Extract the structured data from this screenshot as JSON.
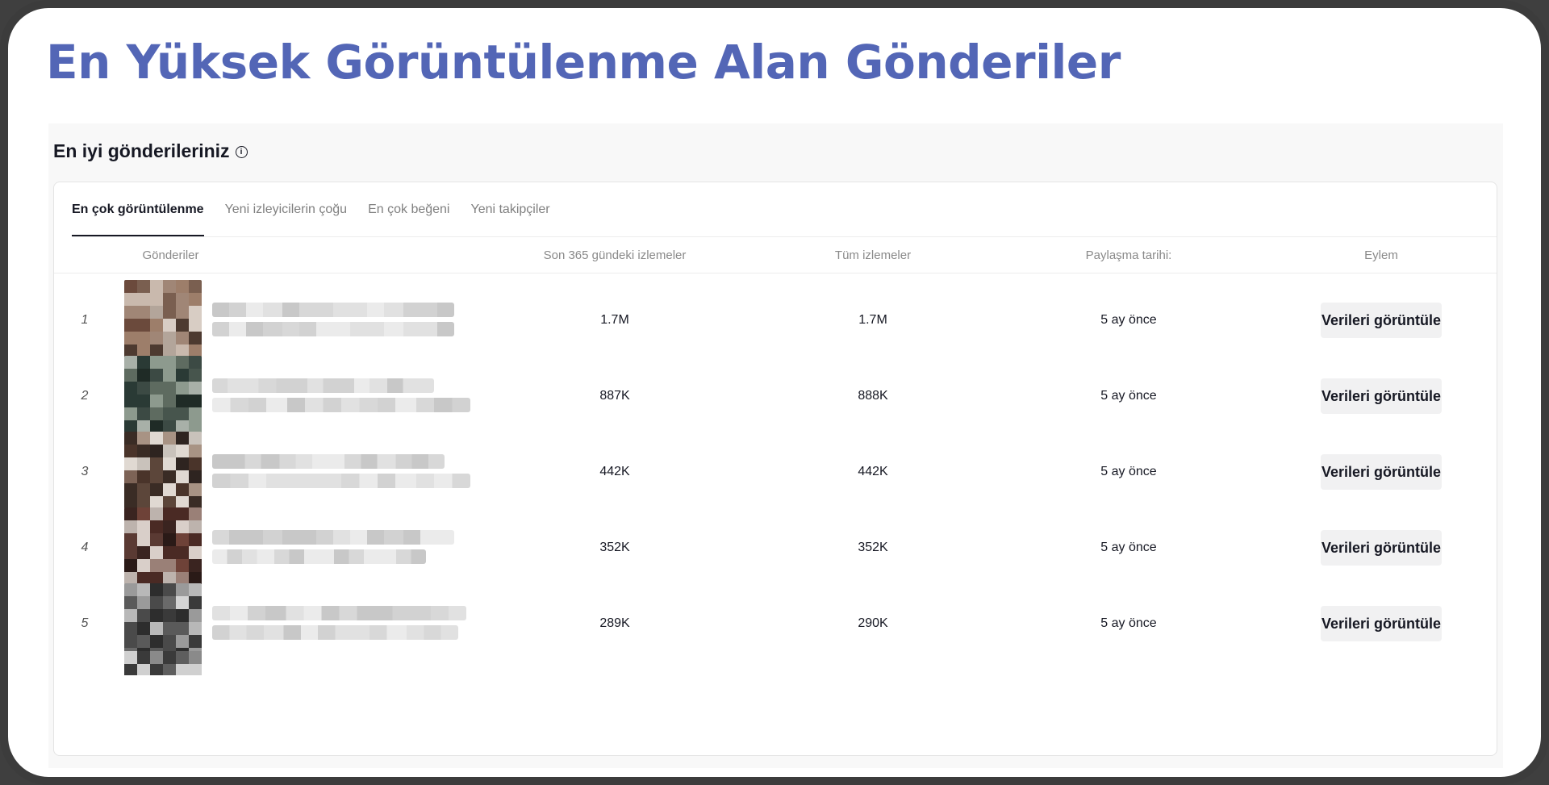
{
  "page_title": "En Yüksek Görüntülenme Alan Gönderiler",
  "panel": {
    "heading": "En iyi gönderileriniz",
    "info_icon": "info-icon"
  },
  "tabs": [
    {
      "label": "En çok görüntülenme",
      "active": true
    },
    {
      "label": "Yeni izleyicilerin çoğu",
      "active": false
    },
    {
      "label": "En çok beğeni",
      "active": false
    },
    {
      "label": "Yeni takipçiler",
      "active": false
    }
  ],
  "table": {
    "headers": {
      "posts": "Gönderiler",
      "last365": "Son 365 gündeki izlemeler",
      "total": "Tüm izlemeler",
      "date": "Paylaşma tarihi:",
      "action": "Eylem"
    },
    "rows": [
      {
        "rank": "1",
        "last365": "1.7M",
        "total": "1.7M",
        "date": "5 ay önce",
        "action": "Verileri görüntüle"
      },
      {
        "rank": "2",
        "last365": "887K",
        "total": "888K",
        "date": "5 ay önce",
        "action": "Verileri görüntüle"
      },
      {
        "rank": "3",
        "last365": "442K",
        "total": "442K",
        "date": "5 ay önce",
        "action": "Verileri görüntüle"
      },
      {
        "rank": "4",
        "last365": "352K",
        "total": "352K",
        "date": "5 ay önce",
        "action": "Verileri görüntüle"
      },
      {
        "rank": "5",
        "last365": "289K",
        "total": "290K",
        "date": "5 ay önce",
        "action": "Verileri görüntüle"
      }
    ]
  },
  "colors": {
    "title": "#5366b6",
    "text": "#161823",
    "muted": "#8a8a8a",
    "button_bg": "#f1f1f2"
  }
}
